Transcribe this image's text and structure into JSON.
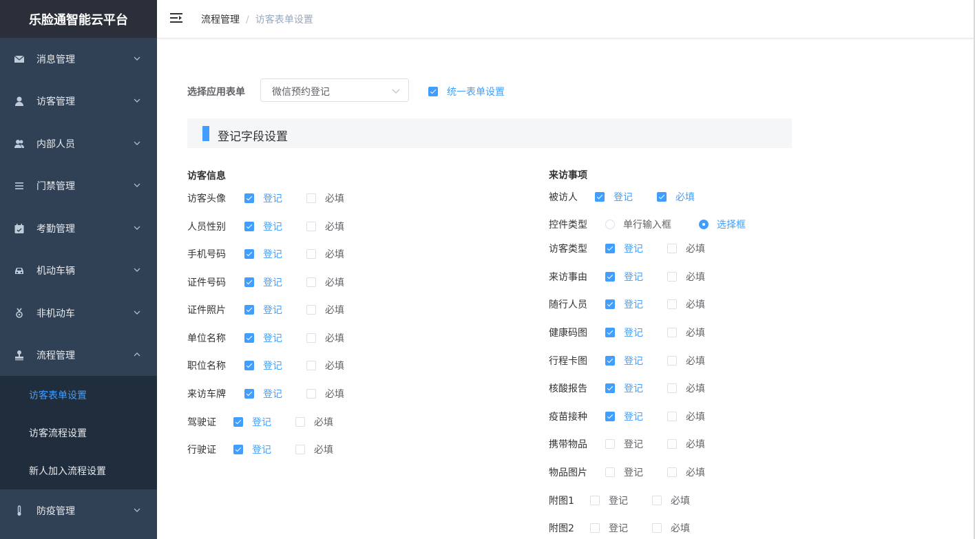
{
  "app": {
    "title": "乐脸通智能云平台"
  },
  "sidebar": {
    "items": [
      {
        "label": "消息管理",
        "icon": "mail-icon"
      },
      {
        "label": "访客管理",
        "icon": "user-icon"
      },
      {
        "label": "内部人员",
        "icon": "users-icon"
      },
      {
        "label": "门禁管理",
        "icon": "list-icon"
      },
      {
        "label": "考勤管理",
        "icon": "calendar-check-icon"
      },
      {
        "label": "机动车辆",
        "icon": "car-icon"
      },
      {
        "label": "非机动车",
        "icon": "bicycle-icon"
      },
      {
        "label": "流程管理",
        "icon": "stamp-icon",
        "expanded": true
      },
      {
        "label": "防疫管理",
        "icon": "thermometer-icon"
      }
    ],
    "subitems": [
      {
        "label": "访客表单设置",
        "active": true
      },
      {
        "label": "访客流程设置",
        "active": false
      },
      {
        "label": "新人加入流程设置",
        "active": false
      }
    ]
  },
  "header": {
    "breadcrumb": [
      "流程管理",
      "访客表单设置"
    ],
    "separator": "/"
  },
  "form_select": {
    "label": "选择应用表单",
    "value": "微信预约登记",
    "unified_label": "统一表单设置",
    "unified_checked": true
  },
  "section": {
    "title": "登记字段设置"
  },
  "left_column": {
    "title": "访客信息",
    "register_label": "登记",
    "required_label": "必填",
    "rows": [
      {
        "name": "访客头像",
        "register": true,
        "required": false
      },
      {
        "name": "人员性别",
        "register": true,
        "required": false
      },
      {
        "name": "手机号码",
        "register": true,
        "required": false
      },
      {
        "name": "证件号码",
        "register": true,
        "required": false
      },
      {
        "name": "证件照片",
        "register": true,
        "required": false
      },
      {
        "name": "单位名称",
        "register": true,
        "required": false
      },
      {
        "name": "职位名称",
        "register": true,
        "required": false
      },
      {
        "name": "来访车牌",
        "register": true,
        "required": false
      },
      {
        "name": "驾驶证",
        "register": true,
        "required": false
      },
      {
        "name": "行驶证",
        "register": true,
        "required": false
      }
    ]
  },
  "right_column": {
    "title": "来访事项",
    "register_label": "登记",
    "required_label": "必填",
    "visitee": {
      "name": "被访人",
      "register": true,
      "required": true
    },
    "control_type": {
      "label": "控件类型",
      "options": [
        "单行输入框",
        "选择框"
      ],
      "selected": "选择框"
    },
    "rows": [
      {
        "name": "访客类型",
        "register": true,
        "required": false
      },
      {
        "name": "来访事由",
        "register": true,
        "required": false
      },
      {
        "name": "随行人员",
        "register": true,
        "required": false
      },
      {
        "name": "健康码图",
        "register": true,
        "required": false
      },
      {
        "name": "行程卡图",
        "register": true,
        "required": false
      },
      {
        "name": "核酸报告",
        "register": true,
        "required": false
      },
      {
        "name": "疫苗接种",
        "register": true,
        "required": false
      },
      {
        "name": "携带物品",
        "register": false,
        "required": false
      },
      {
        "name": "物品图片",
        "register": false,
        "required": false
      },
      {
        "name": "附图1",
        "register": false,
        "required": false
      },
      {
        "name": "附图2",
        "register": false,
        "required": false
      }
    ]
  },
  "colors": {
    "accent": "#409eff",
    "sidebar_bg": "#304156",
    "submenu_bg": "#1f2d3d",
    "brand_bg": "#2b2f3a"
  }
}
